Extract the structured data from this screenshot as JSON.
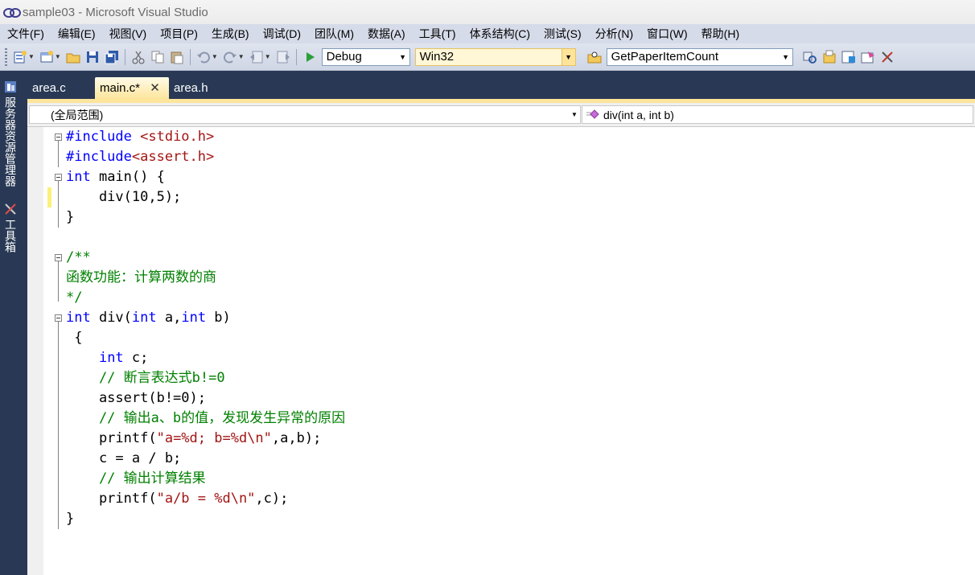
{
  "window": {
    "title": "sample03 - Microsoft Visual Studio"
  },
  "menu": [
    "文件(F)",
    "编辑(E)",
    "视图(V)",
    "项目(P)",
    "生成(B)",
    "调试(D)",
    "团队(M)",
    "数据(A)",
    "工具(T)",
    "体系结构(C)",
    "测试(S)",
    "分析(N)",
    "窗口(W)",
    "帮助(H)"
  ],
  "toolbar": {
    "config": "Debug",
    "platform": "Win32",
    "find": "GetPaperItemCount"
  },
  "siderail": {
    "server_explorer": "服务器资源管理器",
    "toolbox": "工具箱"
  },
  "tabs": [
    {
      "label": "area.c"
    },
    {
      "label": "main.c*"
    },
    {
      "label": "area.h"
    }
  ],
  "nav": {
    "scope": "(全局范围)",
    "member": "div(int a, int b)"
  },
  "code": {
    "l1": {
      "pp": "#include",
      "str": " <stdio.h>"
    },
    "l2": {
      "pp": "#include",
      "str": "<assert.h>"
    },
    "l3": {
      "kw": "int",
      "rest": " main() {"
    },
    "l4": "    div(10,5);",
    "l5": "}",
    "l7": "/**",
    "l8": "函数功能：计算两数的商",
    "l9": "*/",
    "l10": {
      "kw1": "int",
      "t1": " div(",
      "kw2": "int",
      "t2": " a,",
      "kw3": "int",
      "t3": " b)"
    },
    "l11": " {",
    "l12": {
      "indent": "    ",
      "kw": "int",
      "rest": " c;"
    },
    "l13": "    // 断言表达式b!=0",
    "l14": "    assert(b!=0);",
    "l15": "    // 输出a、b的值，发现发生异常的原因",
    "l16": {
      "t1": "    printf(",
      "str": "\"a=%d; b=%d\\n\"",
      "t2": ",a,b);"
    },
    "l17": "    c = a / b;",
    "l18": "    // 输出计算结果",
    "l19": {
      "t1": "    printf(",
      "str": "\"a/b = %d\\n\"",
      "t2": ",c);"
    },
    "l20": "}"
  }
}
